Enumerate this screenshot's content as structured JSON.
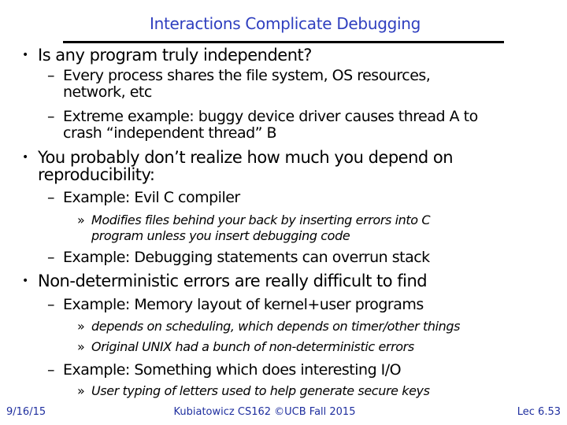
{
  "colors": {
    "title": "#2f3fbf",
    "footer": "#1f2f9f",
    "text": "#000000"
  },
  "slide": {
    "title": "Interactions Complicate Debugging",
    "items": [
      {
        "level": 1,
        "text": "Is any program truly independent?"
      },
      {
        "level": 2,
        "text": "Every process shares the file system, OS resources,"
      },
      {
        "level": 2,
        "text": "network, etc",
        "continuation": true
      },
      {
        "level": 2,
        "text": "Extreme example: buggy device driver causes thread A to"
      },
      {
        "level": 2,
        "text": "crash “independent thread” B",
        "continuation": true
      },
      {
        "level": 1,
        "text": "You probably don’t realize how much you depend on"
      },
      {
        "level": 1,
        "text": "reproducibility:",
        "continuation": true
      },
      {
        "level": 2,
        "text": "Example: Evil C compiler"
      },
      {
        "level": 3,
        "text": "Modifies files behind your back by inserting errors into C"
      },
      {
        "level": 3,
        "text": "program unless you insert debugging code",
        "continuation": true
      },
      {
        "level": 2,
        "text": "Example: Debugging statements can overrun stack"
      },
      {
        "level": 1,
        "text": "Non-deterministic errors are really difficult to find"
      },
      {
        "level": 2,
        "text": "Example: Memory layout of kernel+user programs"
      },
      {
        "level": 3,
        "text": "depends on scheduling, which depends on timer/other things"
      },
      {
        "level": 3,
        "text": "Original UNIX had a bunch of non-deterministic errors"
      },
      {
        "level": 2,
        "text": "Example: Something which does interesting I/O"
      },
      {
        "level": 3,
        "text": "User typing of letters used to help generate secure keys"
      }
    ],
    "markers": {
      "level1": "•",
      "level2": "–",
      "level3": "»"
    }
  },
  "footer": {
    "date": "9/16/15",
    "center": "Kubiatowicz CS162 ©UCB Fall 2015",
    "page": "Lec 6.53"
  }
}
